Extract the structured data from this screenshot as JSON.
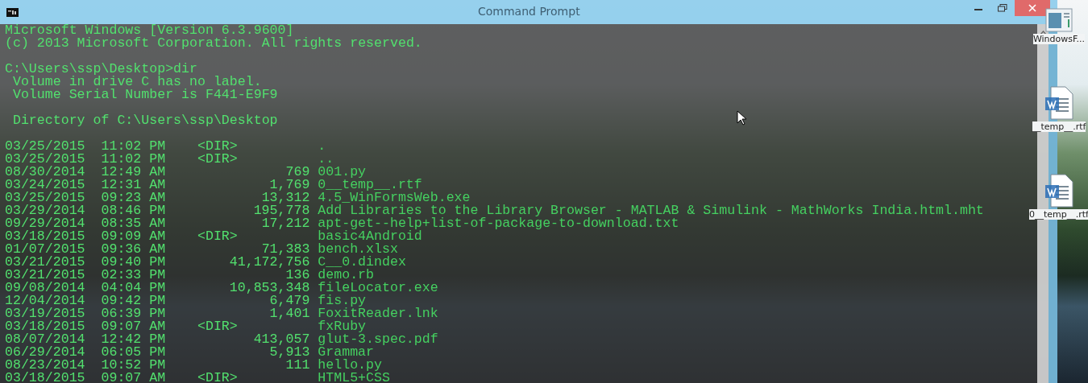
{
  "window": {
    "title": "Command Prompt"
  },
  "console": {
    "header": [
      "Microsoft Windows [Version 6.3.9600]",
      "(c) 2013 Microsoft Corporation. All rights reserved."
    ],
    "prompt": "C:\\Users\\ssp\\Desktop>dir",
    "volume_lines": [
      "Volume in drive C has no label.",
      "Volume Serial Number is F441-E9F9"
    ],
    "directory": "Directory of C:\\Users\\ssp\\Desktop",
    "entries": [
      {
        "date": "03/25/2015",
        "time": "11:02 PM",
        "kind": "dir",
        "size": "<DIR>",
        "name": "."
      },
      {
        "date": "03/25/2015",
        "time": "11:02 PM",
        "kind": "dir",
        "size": "<DIR>",
        "name": ".."
      },
      {
        "date": "08/30/2014",
        "time": "12:49 AM",
        "kind": "file",
        "size": "769",
        "name": "001.py"
      },
      {
        "date": "03/24/2015",
        "time": "12:31 AM",
        "kind": "file",
        "size": "1,769",
        "name": "0__temp__.rtf"
      },
      {
        "date": "03/25/2015",
        "time": "09:23 AM",
        "kind": "file",
        "size": "13,312",
        "name": "4.5_WinFormsWeb.exe"
      },
      {
        "date": "03/29/2014",
        "time": "08:46 PM",
        "kind": "file",
        "size": "195,778",
        "name": "Add Libraries to the Library Browser - MATLAB & Simulink - MathWorks India.html.mht"
      },
      {
        "date": "09/29/2014",
        "time": "08:35 AM",
        "kind": "file",
        "size": "17,212",
        "name": "apt-get--help+list-of-package-to-download.txt"
      },
      {
        "date": "03/18/2015",
        "time": "09:09 AM",
        "kind": "dir",
        "size": "<DIR>",
        "name": "basic4Android"
      },
      {
        "date": "01/07/2015",
        "time": "09:36 AM",
        "kind": "file",
        "size": "71,383",
        "name": "bench.xlsx"
      },
      {
        "date": "03/21/2015",
        "time": "09:40 PM",
        "kind": "file",
        "size": "41,172,756",
        "name": "C__0.dindex"
      },
      {
        "date": "03/21/2015",
        "time": "02:33 PM",
        "kind": "file",
        "size": "136",
        "name": "demo.rb"
      },
      {
        "date": "09/08/2014",
        "time": "04:04 PM",
        "kind": "file",
        "size": "10,853,348",
        "name": "fileLocator.exe"
      },
      {
        "date": "12/04/2014",
        "time": "09:42 PM",
        "kind": "file",
        "size": "6,479",
        "name": "fis.py"
      },
      {
        "date": "03/19/2015",
        "time": "06:39 PM",
        "kind": "file",
        "size": "1,401",
        "name": "FoxitReader.lnk"
      },
      {
        "date": "03/18/2015",
        "time": "09:07 AM",
        "kind": "dir",
        "size": "<DIR>",
        "name": "fxRuby"
      },
      {
        "date": "08/07/2014",
        "time": "12:42 PM",
        "kind": "file",
        "size": "413,057",
        "name": "glut-3.spec.pdf"
      },
      {
        "date": "06/29/2014",
        "time": "06:05 PM",
        "kind": "file",
        "size": "5,913",
        "name": "Grammar"
      },
      {
        "date": "08/23/2014",
        "time": "10:52 PM",
        "kind": "file",
        "size": "111",
        "name": "hello.py"
      },
      {
        "date": "03/18/2015",
        "time": "09:07 AM",
        "kind": "dir",
        "size": "<DIR>",
        "name": "HTML5+CSS"
      }
    ]
  },
  "desktop_icons": [
    {
      "label": "WindowsF...",
      "kind": "window"
    },
    {
      "label": "__temp__.rtf",
      "kind": "document"
    },
    {
      "label": "0__temp__.rtf",
      "kind": "document"
    }
  ]
}
